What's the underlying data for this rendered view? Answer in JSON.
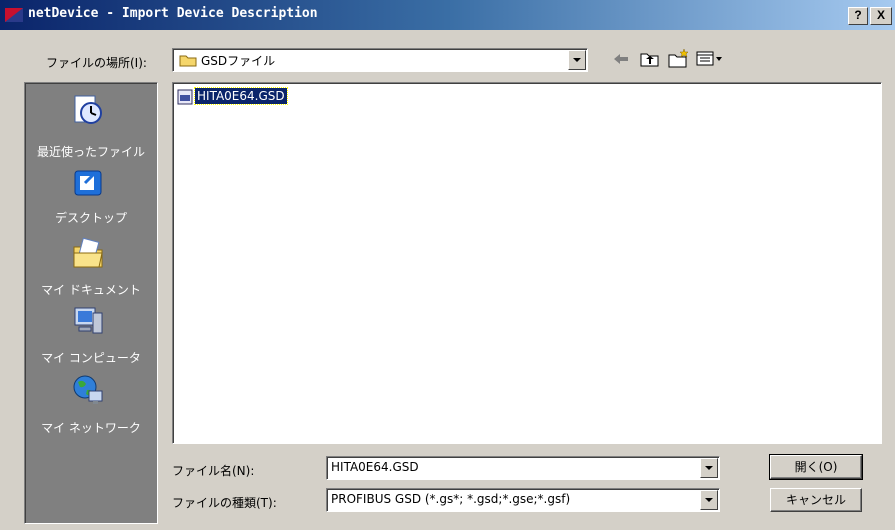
{
  "window": {
    "title": "netDevice - Import Device Description",
    "help_label": "?",
    "close_label": "X"
  },
  "location": {
    "label": "ファイルの場所(I):",
    "value": "GSDファイル"
  },
  "toolbar": {
    "icons": [
      "back-arrow-icon",
      "up-folder-icon",
      "new-folder-icon",
      "view-menu-icon"
    ]
  },
  "places": [
    {
      "label": "最近使ったファイル",
      "icon": "recent-files-icon"
    },
    {
      "label": "デスクトップ",
      "icon": "desktop-icon"
    },
    {
      "label": "マイ ドキュメント",
      "icon": "my-documents-icon"
    },
    {
      "label": "マイ コンピュータ",
      "icon": "my-computer-icon"
    },
    {
      "label": "マイ ネットワーク",
      "icon": "my-network-icon"
    }
  ],
  "files": [
    {
      "name": "HITA0E64.GSD",
      "selected": true
    }
  ],
  "filename": {
    "label": "ファイル名(N):",
    "value": "HITA0E64.GSD"
  },
  "filetype": {
    "label": "ファイルの種類(T):",
    "value": "PROFIBUS GSD (*.gs*; *.gsd;*.gse;*.gsf)"
  },
  "buttons": {
    "open": "開く(O)",
    "cancel": "キャンセル"
  },
  "colors": {
    "titlebar": "#0a246a",
    "selection": "#0a246a",
    "dialog_bg": "#d4d0c8",
    "places_bg": "#808080"
  }
}
